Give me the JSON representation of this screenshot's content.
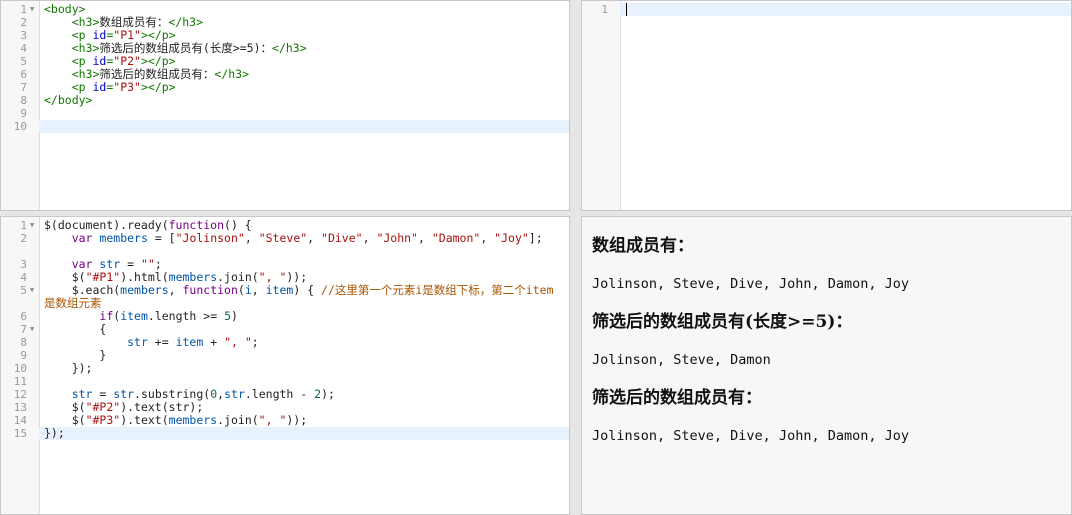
{
  "html_editor": {
    "lines": [
      {
        "n": "1",
        "fold": true,
        "segs": [
          [
            "tag",
            "<body>"
          ]
        ]
      },
      {
        "n": "2",
        "segs": [
          [
            "",
            "    "
          ],
          [
            "tag",
            "<h3>"
          ],
          [
            "",
            "数组成员有："
          ],
          [
            "tag",
            "</h3>"
          ]
        ]
      },
      {
        "n": "3",
        "segs": [
          [
            "",
            "    "
          ],
          [
            "tag",
            "<p "
          ],
          [
            "attr",
            "id"
          ],
          [
            "tag",
            "="
          ],
          [
            "str",
            "\"P1\""
          ],
          [
            "tag",
            "></p>"
          ]
        ]
      },
      {
        "n": "4",
        "segs": [
          [
            "",
            "    "
          ],
          [
            "tag",
            "<h3>"
          ],
          [
            "",
            "筛选后的数组成员有(长度>=5)："
          ],
          [
            "tag",
            "</h3>"
          ]
        ]
      },
      {
        "n": "5",
        "segs": [
          [
            "",
            "    "
          ],
          [
            "tag",
            "<p "
          ],
          [
            "attr",
            "id"
          ],
          [
            "tag",
            "="
          ],
          [
            "str",
            "\"P2\""
          ],
          [
            "tag",
            "></p>"
          ]
        ]
      },
      {
        "n": "6",
        "segs": [
          [
            "",
            "    "
          ],
          [
            "tag",
            "<h3>"
          ],
          [
            "",
            "筛选后的数组成员有："
          ],
          [
            "tag",
            "</h3>"
          ]
        ]
      },
      {
        "n": "7",
        "segs": [
          [
            "",
            "    "
          ],
          [
            "tag",
            "<p "
          ],
          [
            "attr",
            "id"
          ],
          [
            "tag",
            "="
          ],
          [
            "str",
            "\"P3\""
          ],
          [
            "tag",
            "></p>"
          ]
        ]
      },
      {
        "n": "8",
        "segs": [
          [
            "tag",
            "</body>"
          ]
        ]
      },
      {
        "n": "9",
        "segs": []
      },
      {
        "n": "10",
        "active": true,
        "segs": []
      }
    ]
  },
  "css_editor": {
    "lines": [
      {
        "n": "1",
        "active": true,
        "cursor": true,
        "segs": []
      }
    ]
  },
  "js_editor": {
    "lines": [
      {
        "n": "1",
        "fold": true,
        "segs": [
          [
            "",
            "$(document).ready("
          ],
          [
            "kw",
            "function"
          ],
          [
            "",
            "() {"
          ]
        ]
      },
      {
        "n": "2",
        "wrap": true,
        "segs": [
          [
            "",
            "    "
          ],
          [
            "kw",
            "var"
          ],
          [
            "",
            " "
          ],
          [
            "var",
            "members"
          ],
          [
            "",
            " = ["
          ],
          [
            "str",
            "\"Jolinson\""
          ],
          [
            "",
            ", "
          ],
          [
            "str",
            "\"Steve\""
          ],
          [
            "",
            ", "
          ],
          [
            "str",
            "\"Dive\""
          ],
          [
            "",
            ", "
          ],
          [
            "str",
            "\"John\""
          ],
          [
            "",
            ", "
          ],
          [
            "str",
            "\"Damon\""
          ],
          [
            "",
            ", "
          ],
          [
            "str",
            "\"Joy\""
          ],
          [
            "",
            "];"
          ]
        ]
      },
      {
        "n": "3",
        "segs": [
          [
            "",
            "    "
          ],
          [
            "kw",
            "var"
          ],
          [
            "",
            " "
          ],
          [
            "var",
            "str"
          ],
          [
            "",
            " = "
          ],
          [
            "str",
            "\"\""
          ],
          [
            "",
            ";"
          ]
        ]
      },
      {
        "n": "4",
        "segs": [
          [
            "",
            "    $("
          ],
          [
            "str",
            "\"#P1\""
          ],
          [
            "",
            ").html("
          ],
          [
            "var",
            "members"
          ],
          [
            "",
            ".join("
          ],
          [
            "str",
            "\", \""
          ],
          [
            "",
            "));"
          ]
        ]
      },
      {
        "n": "5",
        "fold": true,
        "wrap": true,
        "segs": [
          [
            "",
            "    $.each("
          ],
          [
            "var",
            "members"
          ],
          [
            "",
            ", "
          ],
          [
            "kw",
            "function"
          ],
          [
            "",
            "("
          ],
          [
            "var",
            "i"
          ],
          [
            "",
            ", "
          ],
          [
            "var",
            "item"
          ],
          [
            "",
            ") { "
          ],
          [
            "cm",
            "//这里第一个元素i是数组下标，第二个item是数组元素"
          ]
        ]
      },
      {
        "n": "6",
        "segs": [
          [
            "",
            "        "
          ],
          [
            "kw",
            "if"
          ],
          [
            "",
            "("
          ],
          [
            "var",
            "item"
          ],
          [
            "",
            ".length >= "
          ],
          [
            "num",
            "5"
          ],
          [
            "",
            ")"
          ]
        ]
      },
      {
        "n": "7",
        "fold": true,
        "segs": [
          [
            "",
            "        {"
          ]
        ]
      },
      {
        "n": "8",
        "segs": [
          [
            "",
            "            "
          ],
          [
            "var",
            "str"
          ],
          [
            "",
            " += "
          ],
          [
            "var",
            "item"
          ],
          [
            "",
            " + "
          ],
          [
            "str",
            "\", \""
          ],
          [
            "",
            ";"
          ]
        ]
      },
      {
        "n": "9",
        "segs": [
          [
            "",
            "        }"
          ]
        ]
      },
      {
        "n": "10",
        "segs": [
          [
            "",
            "    });"
          ]
        ]
      },
      {
        "n": "11",
        "segs": []
      },
      {
        "n": "12",
        "segs": [
          [
            "",
            "    "
          ],
          [
            "var",
            "str"
          ],
          [
            "",
            " = "
          ],
          [
            "var",
            "str"
          ],
          [
            "",
            ".substring("
          ],
          [
            "num",
            "0"
          ],
          [
            "",
            ","
          ],
          [
            "var",
            "str"
          ],
          [
            "",
            ".length - "
          ],
          [
            "num",
            "2"
          ],
          [
            "",
            ");"
          ]
        ]
      },
      {
        "n": "13",
        "segs": [
          [
            "",
            "    $("
          ],
          [
            "str",
            "\"#P2\""
          ],
          [
            "",
            ").text(str);"
          ]
        ]
      },
      {
        "n": "14",
        "segs": [
          [
            "",
            "    $("
          ],
          [
            "str",
            "\"#P3\""
          ],
          [
            "",
            ").text("
          ],
          [
            "var",
            "members"
          ],
          [
            "",
            ".join("
          ],
          [
            "str",
            "\", \""
          ],
          [
            "",
            "));"
          ]
        ]
      },
      {
        "n": "15",
        "active": true,
        "segs": [
          [
            "",
            "});"
          ]
        ]
      }
    ]
  },
  "output": {
    "h1": "数组成员有：",
    "p1": "Jolinson, Steve, Dive, John, Damon, Joy",
    "h2": "筛选后的数组成员有(长度>=5)：",
    "p2": "Jolinson, Steve, Damon",
    "h3": "筛选后的数组成员有：",
    "p3": "Jolinson, Steve, Dive, John, Damon, Joy"
  },
  "colors": {
    "tag": "#117700",
    "attr": "#0000cc",
    "string": "#aa1111",
    "keyword": "#770088",
    "variable": "#0055aa",
    "number": "#116644",
    "comment": "#aa5500",
    "active_line": "#e8f2ff"
  }
}
